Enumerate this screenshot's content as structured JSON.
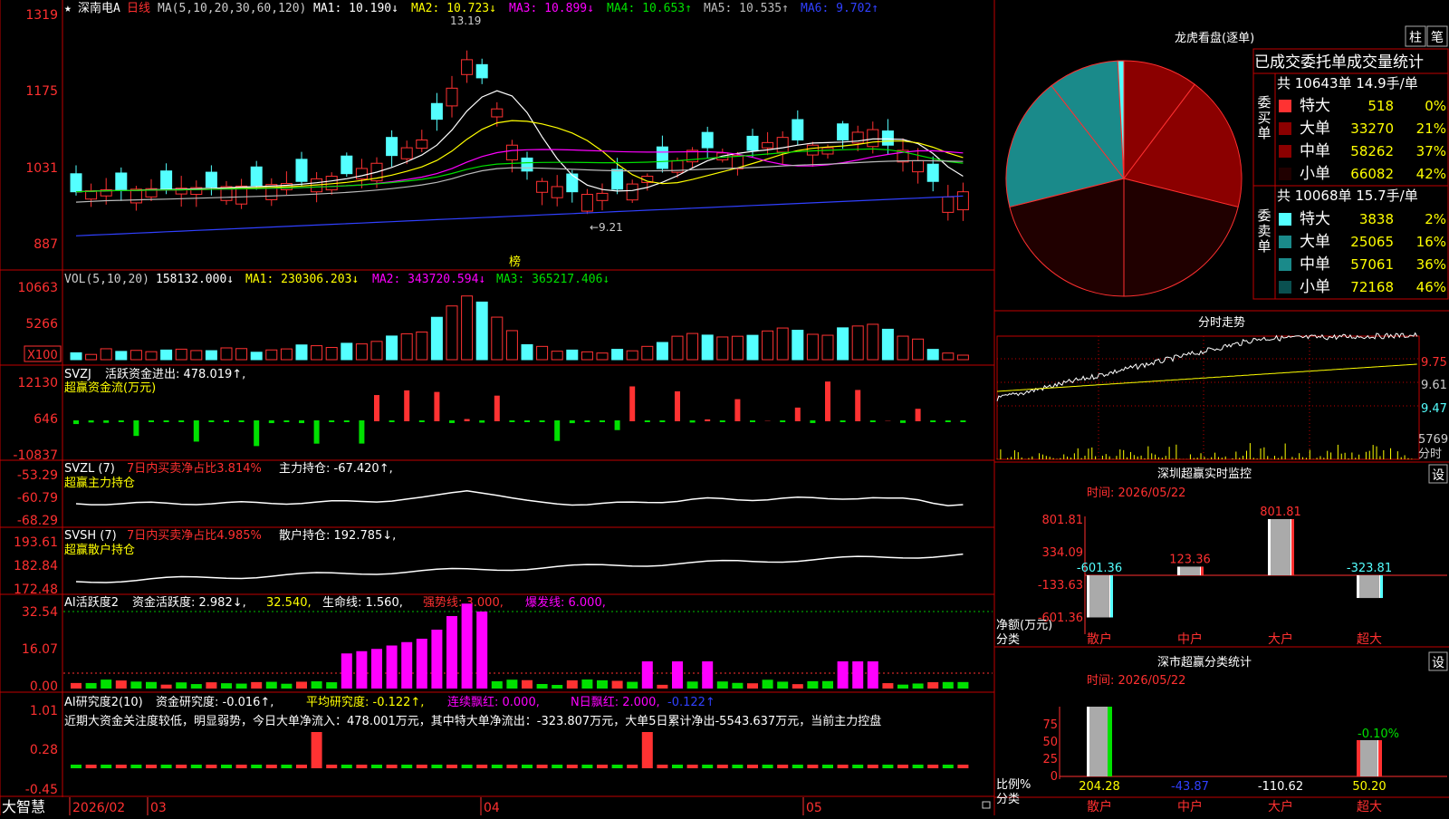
{
  "colors": {
    "up": "#ff3232",
    "down": "#54ffff",
    "frame": "#c00000",
    "axis_text": "#ff3030",
    "white": "#ffffff",
    "yellow": "#ffff00",
    "magenta": "#ff00ff",
    "green": "#00e000",
    "gray": "#bbbbbb",
    "blue": "#3040ff",
    "pie_red": "#8b0000",
    "pie_dark": "#200000",
    "pie_teal": "#1a8a8a"
  },
  "main": {
    "star": "★",
    "stock_name": "深南电A",
    "period": "日线",
    "ma_params": "MA(5,10,20,30,60,120)",
    "ma1": "MA1: 10.190↓",
    "ma2": "MA2: 10.723↓",
    "ma3": "MA3: 10.899↓",
    "ma4": "MA4: 10.653↑",
    "ma5": "MA5: 10.535↑",
    "ma6": "MA6: 9.702↑",
    "y_ticks": [
      "1319",
      "1175",
      "1031",
      "887"
    ],
    "high_label": "13.19",
    "low_label": "←9.21",
    "bang_label": "榜"
  },
  "vol": {
    "header_name": "VOL(5,10,20)",
    "header_value": "158132.000↓",
    "ma1": "MA1: 230306.203↓",
    "ma2": "MA2: 343720.594↓",
    "ma3": "MA3: 365217.406↓",
    "y_ticks": [
      "10663",
      "5266"
    ],
    "unit": "X100"
  },
  "svzj": {
    "name": "SVZJ",
    "line1": "活跃资金进出: 478.019↑,",
    "line2": "超赢资金流(万元)",
    "y_ticks": [
      "12130",
      "646",
      "-10837"
    ]
  },
  "svzl": {
    "name": "SVZL (7)",
    "ratio": "7日内买卖净占比3.814%",
    "hold": "主力持仓: -67.420↑,",
    "line2": "超赢主力持仓",
    "y_ticks": [
      "-53.29",
      "-60.79",
      "-68.29"
    ]
  },
  "svsh": {
    "name": "SVSH (7)",
    "ratio": "7日内买卖净占比4.985%",
    "hold": "散户持仓: 192.785↓,",
    "line2": "超赢散户持仓",
    "y_ticks": [
      "193.61",
      "182.84",
      "172.48"
    ]
  },
  "ai1": {
    "name": "AI活跃度2",
    "a": "资金活跃度: 2.982↓,",
    "b": "32.540,",
    "c": "生命线: 1.560,",
    "d": "强势线: 3.000,",
    "e": "爆发线: 6.000,",
    "y_ticks": [
      "32.54",
      "16.07",
      "0.00"
    ]
  },
  "ai2": {
    "name": "AI研究度2(10)",
    "a": "资金研究度: -0.016↑,",
    "b": "平均研究度: -0.122↑,",
    "c": "连续飘红: 0.000,",
    "d": "N日飘红: 2.000,",
    "e": "-0.122↑",
    "comment": "近期大资金关注度较低，明显弱势，今日大单净流入：478.001万元，其中特大单净流出：-323.807万元，大单5日累计净出-5543.637万元，当前主力控盘",
    "y_ticks": [
      "1.01",
      "0.28",
      "-0.45"
    ]
  },
  "bottom": {
    "brand": "大智慧",
    "date_labels": [
      "2026/02",
      "03",
      "04",
      "05"
    ]
  },
  "dragon": {
    "title": "龙虎看盘(逐单)",
    "btn1": "柱",
    "btn2": "笔",
    "subtitle": "已成交委托单成交量统计",
    "buy_label": "委买单",
    "sell_label": "委卖单",
    "buy_total": "共 10643单 14.9手/单",
    "sell_total": "共 10068单 15.7手/单",
    "buy_rows": [
      {
        "name": "特大",
        "vol": "518",
        "pct": "0%"
      },
      {
        "name": "大单",
        "vol": "33270",
        "pct": "21%"
      },
      {
        "name": "中单",
        "vol": "58262",
        "pct": "37%"
      },
      {
        "name": "小单",
        "vol": "66082",
        "pct": "42%"
      }
    ],
    "sell_rows": [
      {
        "name": "特大",
        "vol": "3838",
        "pct": "2%"
      },
      {
        "name": "大单",
        "vol": "25065",
        "pct": "16%"
      },
      {
        "name": "中单",
        "vol": "57061",
        "pct": "36%"
      },
      {
        "name": "小单",
        "vol": "72168",
        "pct": "46%"
      }
    ]
  },
  "minute": {
    "title": "分时走势",
    "y_ticks": [
      "9.75",
      "9.61",
      "9.47"
    ],
    "vol_label": "5769",
    "fen_label": "分时"
  },
  "monitor": {
    "title": "深圳超赢实时监控",
    "btn": "设",
    "time": "时间: 2026/05/22",
    "y_ticks": [
      "801.81",
      "334.09",
      "-133.63",
      "-601.36"
    ],
    "y_label1": "净额(万元)",
    "y_label2": "分类",
    "categories": [
      "散户",
      "中户",
      "大户",
      "超大"
    ],
    "values": [
      -601.36,
      123.36,
      801.81,
      -323.81
    ],
    "value_labels": [
      "-601.36",
      "123.36",
      "801.81",
      "-323.81"
    ]
  },
  "classify": {
    "title": "深市超赢分类统计",
    "btn": "设",
    "time": "时间: 2026/05/22",
    "y_ticks": [
      "75",
      "50",
      "25",
      "0"
    ],
    "y_label1": "比例%",
    "y_label2": "分类",
    "categories": [
      "散户",
      "中户",
      "大户",
      "超大"
    ],
    "pct_label": "-0.10%",
    "values": [
      "204.28",
      "-43.87",
      "-110.62",
      "50.20"
    ]
  },
  "chart_data": {
    "type": "bar",
    "title": "深圳超赢实时监控",
    "categories": [
      "散户",
      "中户",
      "大户",
      "超大"
    ],
    "values": [
      -601.36,
      123.36,
      801.81,
      -323.81
    ],
    "ylim": [
      -601.36,
      801.81
    ]
  }
}
